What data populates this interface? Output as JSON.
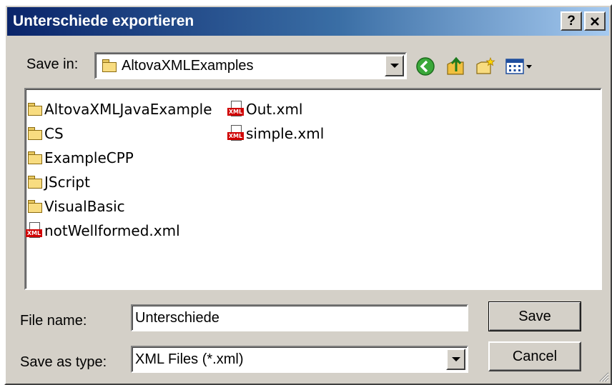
{
  "window": {
    "title": "Unterschiede exportieren",
    "help_label": "?",
    "close_label": "✕"
  },
  "toolbar": {
    "save_in_label": "Save in:",
    "location": "AltovaXMLExamples",
    "icons": [
      "back-icon",
      "up-folder-icon",
      "new-folder-icon",
      "view-menu-icon"
    ]
  },
  "files": {
    "column1": [
      {
        "type": "folder",
        "name": "AltovaXMLJavaExample"
      },
      {
        "type": "folder",
        "name": "CS"
      },
      {
        "type": "folder",
        "name": "ExampleCPP"
      },
      {
        "type": "folder",
        "name": "JScript"
      },
      {
        "type": "folder",
        "name": "VisualBasic"
      },
      {
        "type": "xml",
        "name": "notWellformed.xml"
      }
    ],
    "column2": [
      {
        "type": "xml",
        "name": "Out.xml"
      },
      {
        "type": "xml",
        "name": "simple.xml"
      }
    ],
    "xml_badge": "XML"
  },
  "form": {
    "file_name_label": "File name:",
    "file_name_value": "Unterschiede",
    "save_as_type_label": "Save as type:",
    "save_as_type_value": "XML Files (*.xml)"
  },
  "buttons": {
    "save_label": "Save",
    "cancel_label": "Cancel"
  },
  "colors": {
    "title_gradient_start": "#0a246a",
    "title_gradient_end": "#a6caf0",
    "dialog_face": "#d4d0c8",
    "xml_badge": "#d00000",
    "folder": "#f8dc80"
  }
}
